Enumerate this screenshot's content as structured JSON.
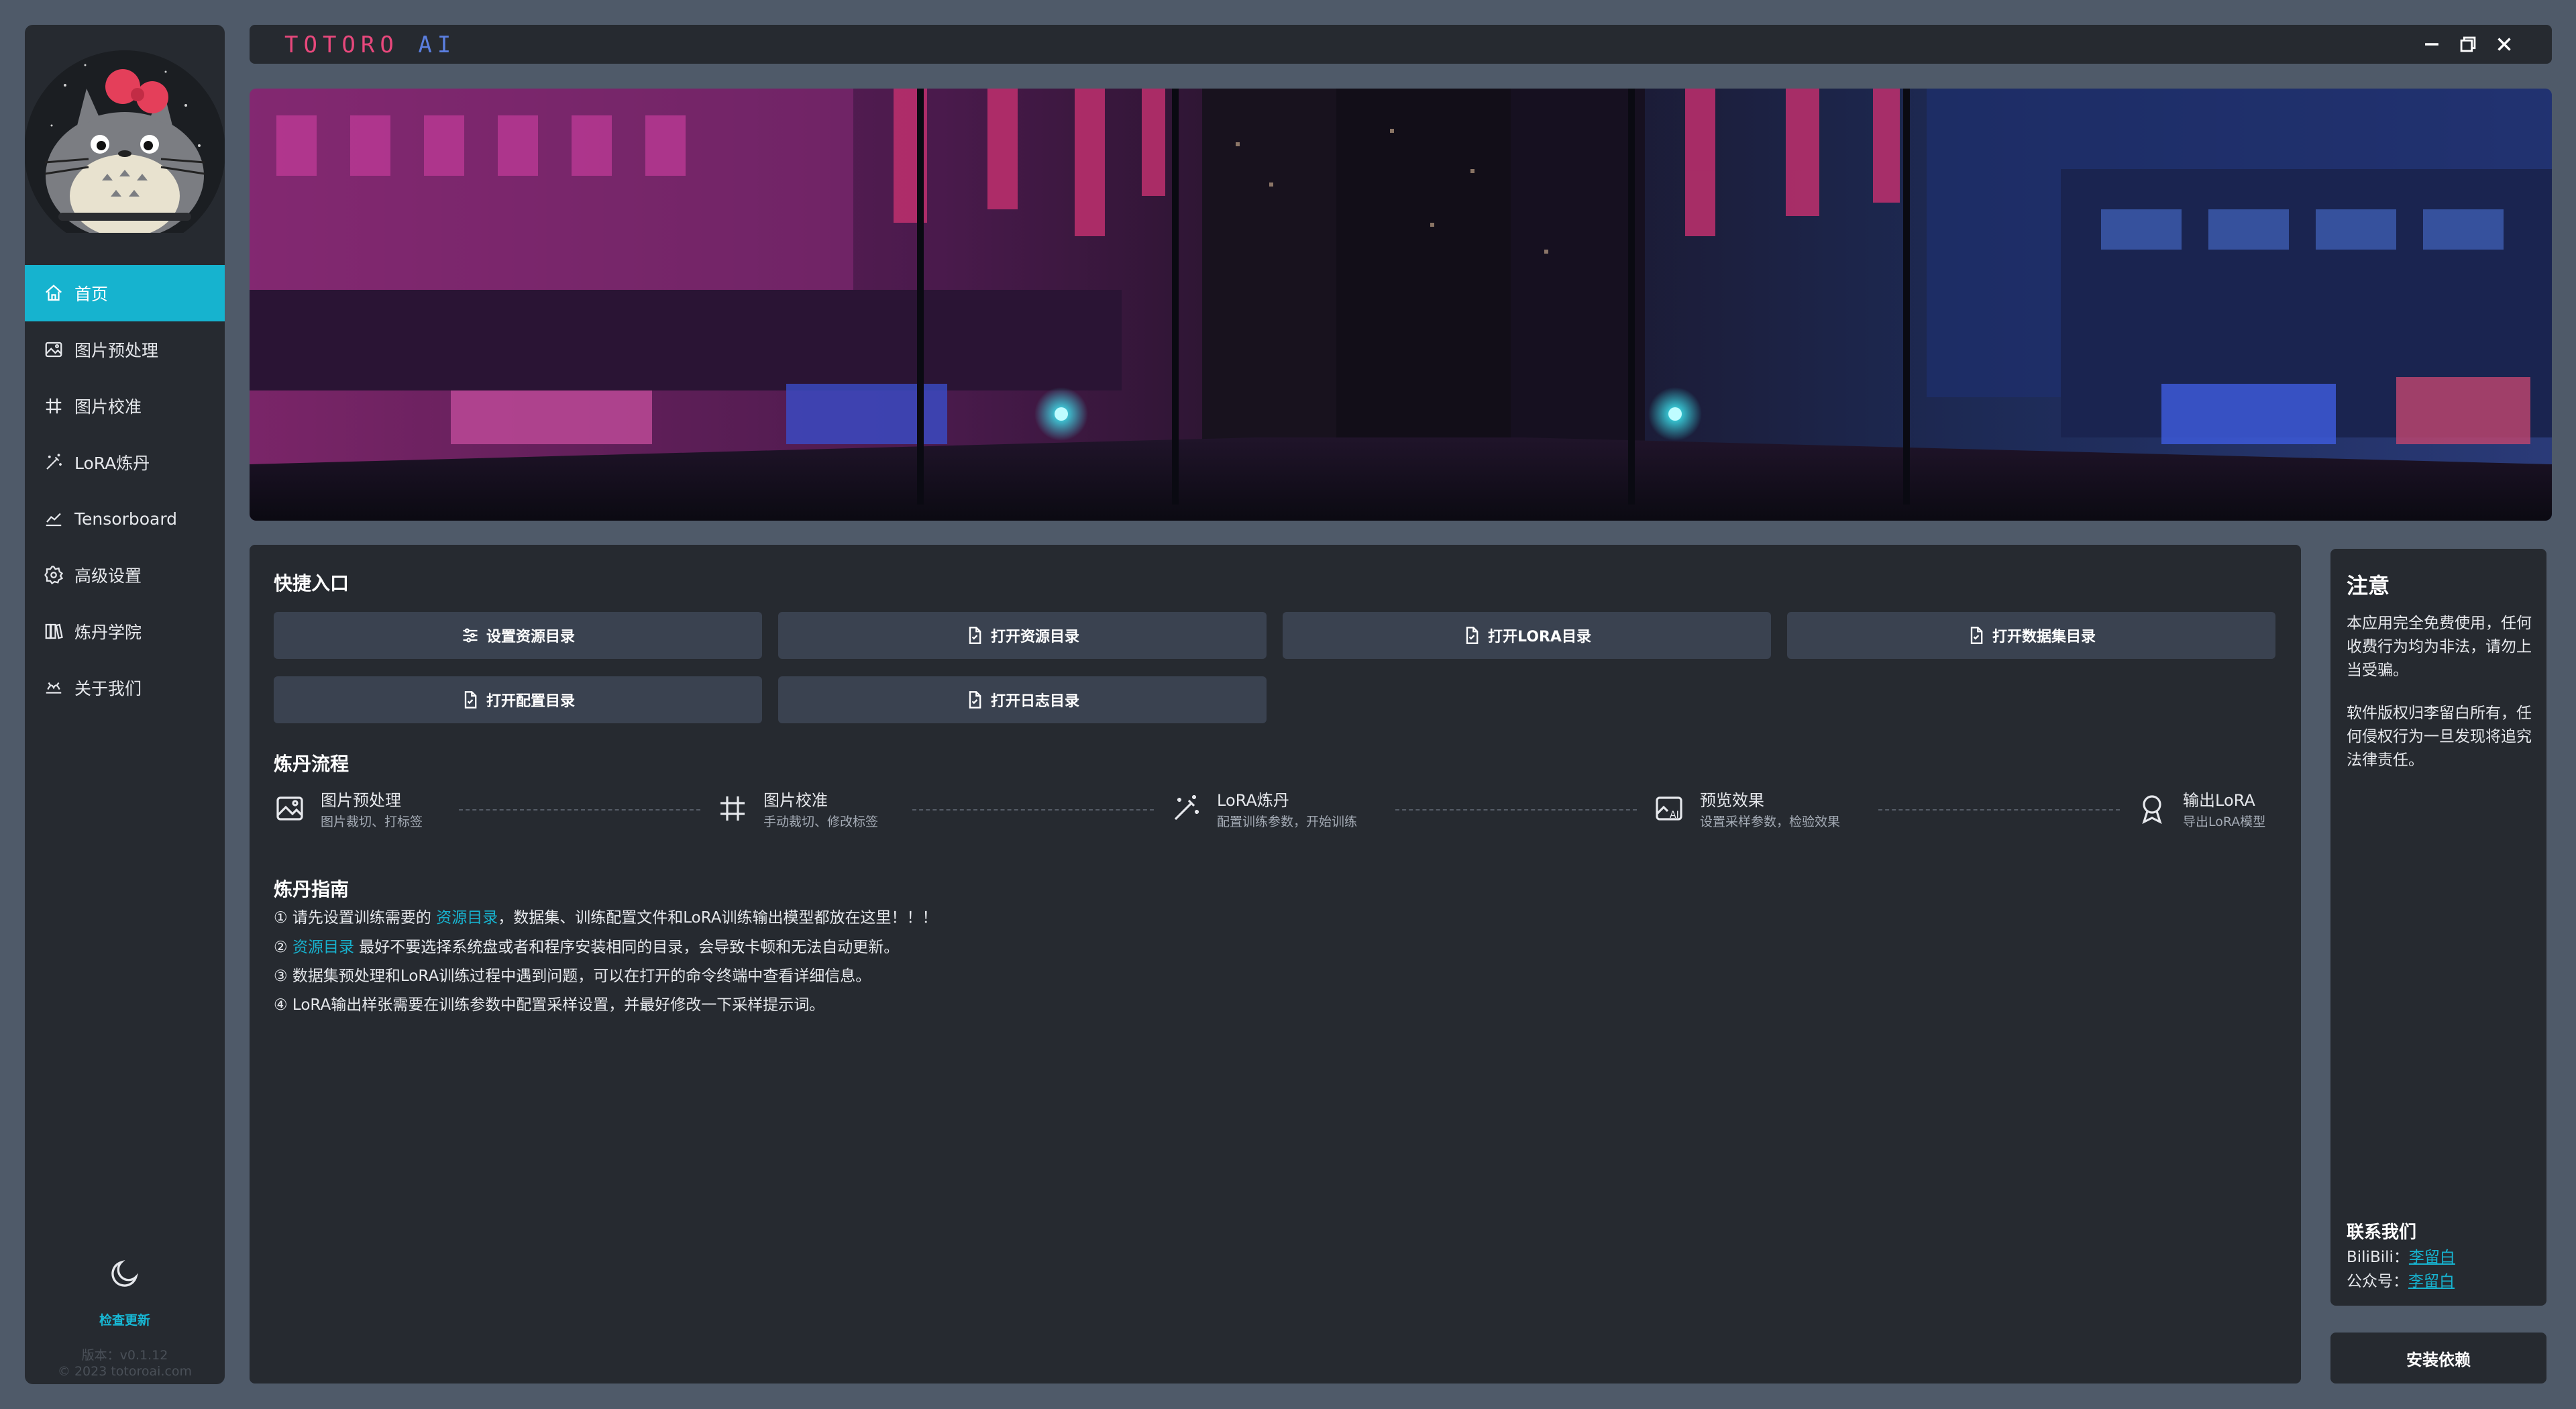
{
  "app": {
    "brand_part1": "TOTORO",
    "brand_part2": "AI"
  },
  "sidebar": {
    "items": [
      {
        "label": "首页",
        "icon": "home-icon",
        "active": true
      },
      {
        "label": "图片预处理",
        "icon": "image-icon"
      },
      {
        "label": "图片校准",
        "icon": "crop-icon"
      },
      {
        "label": "LoRA炼丹",
        "icon": "magic-wand-icon"
      },
      {
        "label": "Tensorboard",
        "icon": "chart-line-icon"
      },
      {
        "label": "高级设置",
        "icon": "gear-icon"
      },
      {
        "label": "炼丹学院",
        "icon": "books-icon"
      },
      {
        "label": "关于我们",
        "icon": "about-icon"
      }
    ],
    "update_label": "检查更新",
    "version": "版本：v0.1.12",
    "copyright": "© 2023 totoroai.com"
  },
  "quick": {
    "title": "快捷入口",
    "buttons": [
      "设置资源目录",
      "打开资源目录",
      "打开LORA目录",
      "打开数据集目录",
      "打开配置目录",
      "打开日志目录"
    ]
  },
  "flow": {
    "title": "炼丹流程",
    "steps": [
      {
        "title": "图片预处理",
        "desc": "图片裁切、打标签"
      },
      {
        "title": "图片校准",
        "desc": "手动裁切、修改标签"
      },
      {
        "title": "LoRA炼丹",
        "desc": "配置训练参数，开始训练"
      },
      {
        "title": "预览效果",
        "desc": "设置采样参数，检验效果"
      },
      {
        "title": "输出LoRA",
        "desc": "导出LoRA模型"
      }
    ]
  },
  "guide": {
    "title": "炼丹指南",
    "line1_a": "① 请先设置训练需要的 ",
    "line1_link": "资源目录",
    "line1_b": "，数据集、训练配置文件和LoRA训练输出模型都放在这里！！！",
    "line2_a": "② ",
    "line2_link": "资源目录",
    "line2_b": " 最好不要选择系统盘或者和程序安装相同的目录，会导致卡顿和无法自动更新。",
    "line3": "③ 数据集预处理和LoRA训练过程中遇到问题，可以在打开的命令终端中查看详细信息。",
    "line4": "④ LoRA输出样张需要在训练参数中配置采样设置，并最好修改一下采样提示词。"
  },
  "notice": {
    "title": "注意",
    "para1": "本应用完全免费使用，任何收费行为均为非法，请勿上当受骗。",
    "para2": "软件版权归李留白所有，任何侵权行为一旦发现将追究法律责任。",
    "contact_title": "联系我们",
    "bilibili_label": "BiliBili：",
    "bilibili_value": "李留白",
    "wechat_label": "公众号：",
    "wechat_value": "李留白"
  },
  "install_label": "安装依赖",
  "colors": {
    "accent": "#16b3cf",
    "panel": "#262a30",
    "button": "#3a4250",
    "background": "#4f5a69"
  }
}
